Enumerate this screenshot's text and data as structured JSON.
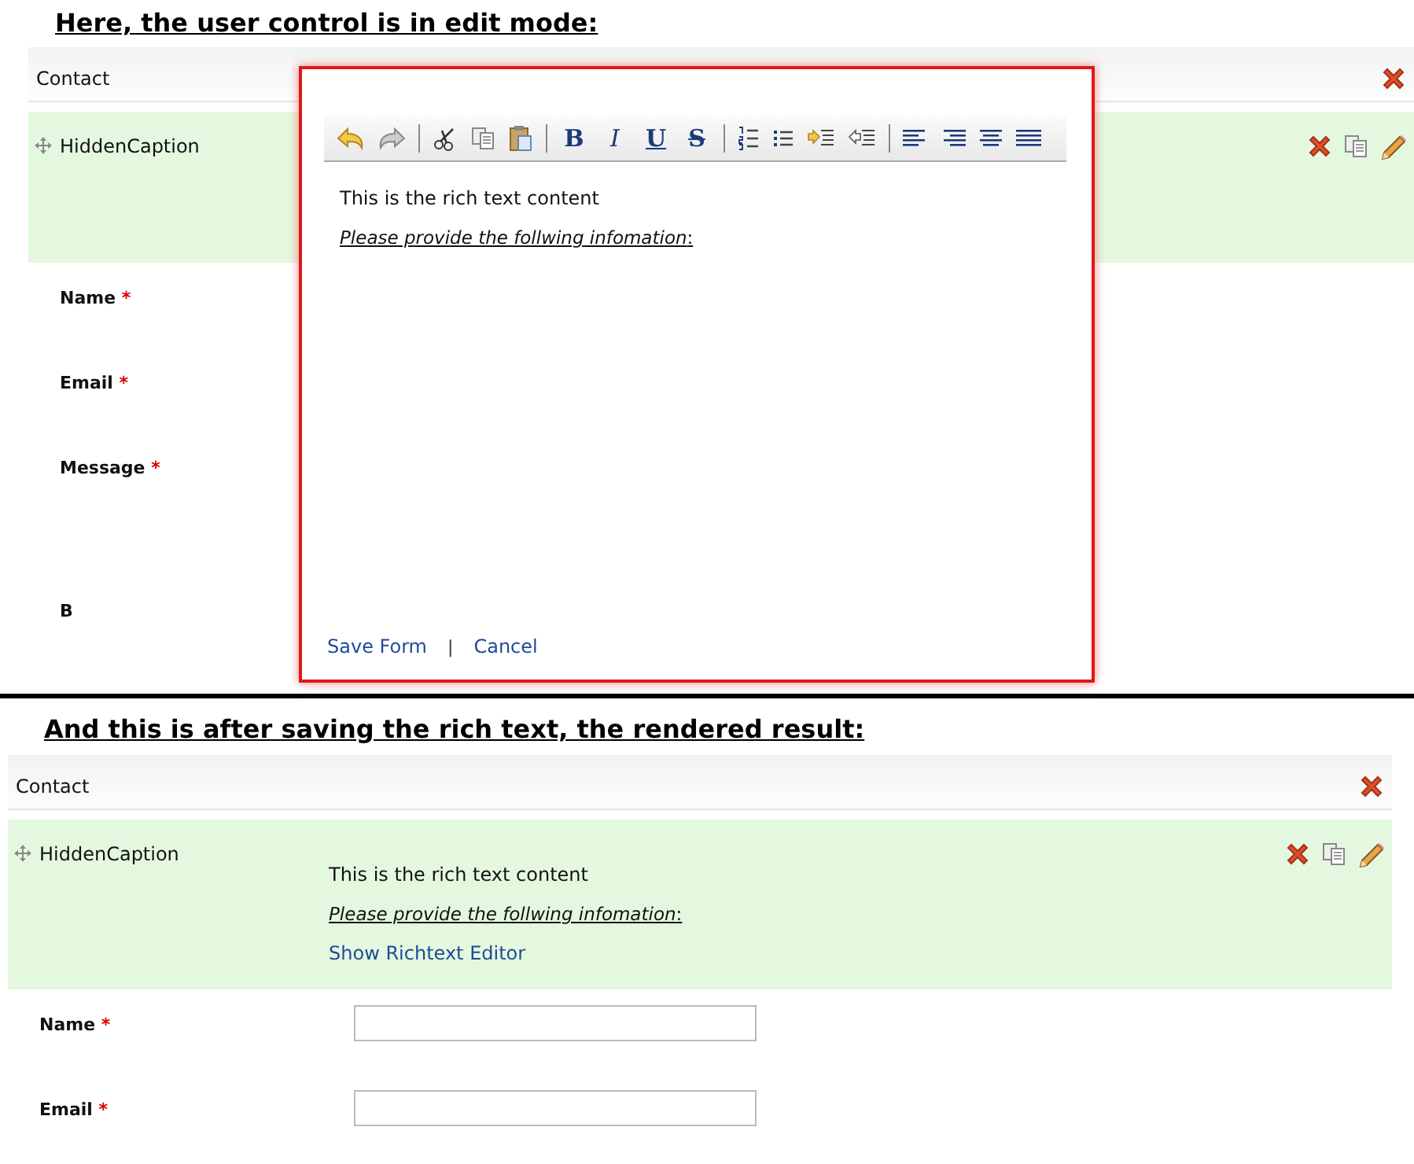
{
  "edit_mode": {
    "heading": "Here, the user control is in edit mode:",
    "form": {
      "title": "Contact",
      "caption": "HiddenCaption",
      "fields": [
        {
          "label": "Name",
          "required_mark": "*"
        },
        {
          "label": "Email",
          "required_mark": "*"
        },
        {
          "label": "Message",
          "required_mark": "*",
          "kind": "tall"
        },
        {
          "label": "B"
        }
      ]
    },
    "editor": {
      "toolbar": [
        [
          {
            "kind": "undo"
          },
          {
            "kind": "redo"
          }
        ],
        [
          {
            "kind": "cut"
          },
          {
            "kind": "copy"
          },
          {
            "kind": "paste"
          }
        ],
        [
          {
            "kind": "bold",
            "label": "B"
          },
          {
            "kind": "italic",
            "label": "I"
          },
          {
            "kind": "underline",
            "label": "U"
          },
          {
            "kind": "strike",
            "label": "S"
          }
        ],
        [
          {
            "kind": "ordered-list"
          },
          {
            "kind": "bullet-list"
          },
          {
            "kind": "indent"
          },
          {
            "kind": "outdent"
          }
        ],
        [
          {
            "kind": "align-left"
          },
          {
            "kind": "align-right"
          },
          {
            "kind": "align-center"
          },
          {
            "kind": "justify"
          }
        ]
      ],
      "content": [
        "This is the rich text content",
        "*Please provide the follwing infomation*:"
      ],
      "save": "Save Form",
      "separator": "|",
      "cancel": "Cancel"
    }
  },
  "rendered": {
    "heading": "And this is after saving the rich text, the rendered result:",
    "form": {
      "title": "Contact",
      "caption": "HiddenCaption",
      "content": [
        "This is the rich text content",
        "*Please provide the follwing infomation*:"
      ],
      "link": "Show Richtext Editor",
      "fields": [
        {
          "label": "Name",
          "required_mark": "*",
          "kind": "input"
        },
        {
          "label": "Email",
          "required_mark": "*",
          "kind": "input"
        }
      ]
    }
  }
}
